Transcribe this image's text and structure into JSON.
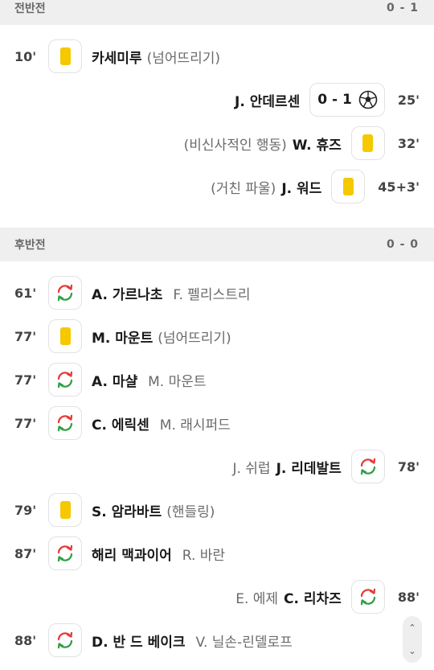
{
  "first_half": {
    "label": "전반전",
    "score": "0 - 1"
  },
  "second_half": {
    "label": "후반전",
    "score": "0 - 0"
  },
  "events_first": [
    {
      "minute": "10'",
      "player": "카세미루",
      "detail": "(넘어뜨리기)",
      "type": "yellow-card",
      "side": "left"
    },
    {
      "minute": "25'",
      "player": "J. 안데르센",
      "score": "0 - 1",
      "type": "goal",
      "side": "right"
    },
    {
      "minute": "32'",
      "player": "W. 휴즈",
      "detail": "(비신사적인 행동)",
      "type": "yellow-card",
      "side": "right"
    },
    {
      "minute": "45+3'",
      "player": "J. 워드",
      "detail": "(거친 파울)",
      "type": "yellow-card",
      "side": "right"
    }
  ],
  "events_second": [
    {
      "minute": "61'",
      "player": "A. 가르나초",
      "detail": "F. 펠리스트리",
      "type": "substitution",
      "side": "left"
    },
    {
      "minute": "77'",
      "player": "M. 마운트",
      "detail": "(넘어뜨리기)",
      "type": "yellow-card",
      "side": "left"
    },
    {
      "minute": "77'",
      "player": "A. 마샬",
      "detail": "M. 마운트",
      "type": "substitution",
      "side": "left"
    },
    {
      "minute": "77'",
      "player": "C. 에릭센",
      "detail": "M. 래시퍼드",
      "type": "substitution",
      "side": "left"
    },
    {
      "minute": "78'",
      "player": "J. 리데발트",
      "detail": "J. 쉬럽",
      "type": "substitution",
      "side": "right"
    },
    {
      "minute": "79'",
      "player": "S. 암라바트",
      "detail": "(핸들링)",
      "type": "yellow-card",
      "side": "left"
    },
    {
      "minute": "87'",
      "player": "해리 맥과이어",
      "detail": "R. 바란",
      "type": "substitution",
      "side": "left"
    },
    {
      "minute": "88'",
      "player": "C. 리차즈",
      "detail": "E. 에제",
      "type": "substitution",
      "side": "right"
    },
    {
      "minute": "88'",
      "player": "D. 반 드 베이크",
      "detail": "V. 닐손-린델로프",
      "type": "substitution",
      "side": "left"
    }
  ],
  "colors": {
    "yellow_card": "#f5c800",
    "sub_in": "#e53935",
    "sub_out": "#2e9e44",
    "header_bg": "#efefef"
  },
  "icons": {
    "yellow_card": "yellow-card-icon",
    "goal": "football-icon",
    "substitution": "substitution-icon",
    "scroll_up": "chevron-up-icon",
    "scroll_down": "chevron-down-icon"
  }
}
